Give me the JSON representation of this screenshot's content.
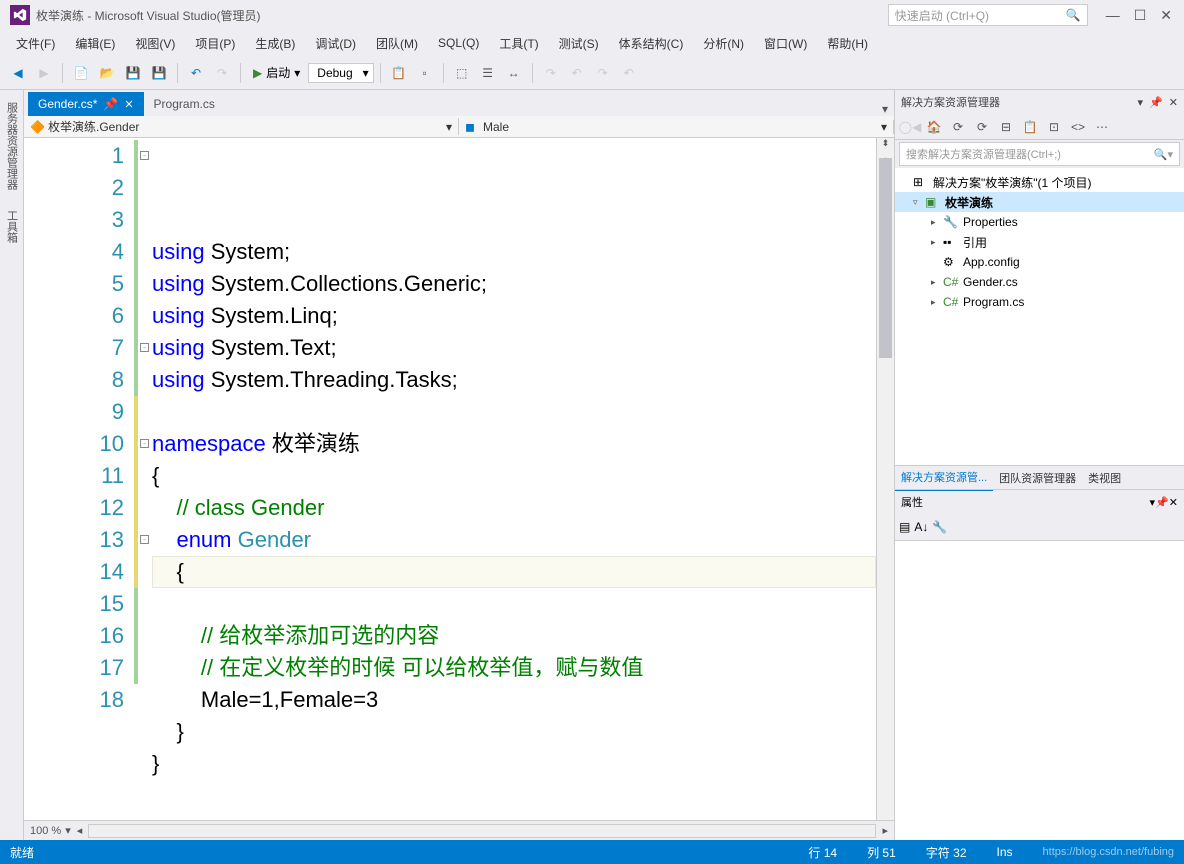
{
  "window": {
    "title": "枚举演练 - Microsoft Visual Studio(管理员)",
    "quicklaunch_placeholder": "快速启动 (Ctrl+Q)"
  },
  "menu": {
    "file": "文件(F)",
    "edit": "编辑(E)",
    "view": "视图(V)",
    "project": "项目(P)",
    "build": "生成(B)",
    "debug": "调试(D)",
    "team": "团队(M)",
    "sql": "SQL(Q)",
    "tools": "工具(T)",
    "test": "测试(S)",
    "architecture": "体系结构(C)",
    "analyze": "分析(N)",
    "window": "窗口(W)",
    "help": "帮助(H)"
  },
  "toolbar": {
    "start_label": "启动",
    "config": "Debug"
  },
  "side_panels": {
    "server_explorer": "服务器资源管理器",
    "toolbox": "工具箱"
  },
  "tabs": {
    "active": "Gender.cs*",
    "inactive": "Program.cs"
  },
  "navbar": {
    "left": "枚举演练.Gender",
    "right": "Male"
  },
  "code_lines": [
    {
      "n": 1,
      "tokens": [
        {
          "t": "using",
          "c": "kw"
        },
        {
          "t": " System;",
          "c": ""
        }
      ]
    },
    {
      "n": 2,
      "tokens": [
        {
          "t": "using",
          "c": "kw"
        },
        {
          "t": " System.Collections.Generic;",
          "c": ""
        }
      ]
    },
    {
      "n": 3,
      "tokens": [
        {
          "t": "using",
          "c": "kw"
        },
        {
          "t": " System.Linq;",
          "c": ""
        }
      ]
    },
    {
      "n": 4,
      "tokens": [
        {
          "t": "using",
          "c": "kw"
        },
        {
          "t": " System.Text;",
          "c": ""
        }
      ]
    },
    {
      "n": 5,
      "tokens": [
        {
          "t": "using",
          "c": "kw"
        },
        {
          "t": " System.Threading.Tasks;",
          "c": ""
        }
      ]
    },
    {
      "n": 6,
      "tokens": []
    },
    {
      "n": 7,
      "tokens": [
        {
          "t": "namespace",
          "c": "kw"
        },
        {
          "t": " 枚举演练",
          "c": ""
        }
      ]
    },
    {
      "n": 8,
      "tokens": [
        {
          "t": "{",
          "c": ""
        }
      ]
    },
    {
      "n": 9,
      "tokens": [
        {
          "t": "    ",
          "c": ""
        },
        {
          "t": "// class Gender",
          "c": "cm"
        }
      ]
    },
    {
      "n": 10,
      "tokens": [
        {
          "t": "    ",
          "c": ""
        },
        {
          "t": "enum",
          "c": "kw"
        },
        {
          "t": " ",
          "c": ""
        },
        {
          "t": "Gender",
          "c": "tp"
        }
      ]
    },
    {
      "n": 11,
      "tokens": [
        {
          "t": "    {",
          "c": ""
        }
      ]
    },
    {
      "n": 12,
      "tokens": []
    },
    {
      "n": 13,
      "tokens": [
        {
          "t": "        ",
          "c": ""
        },
        {
          "t": "// 给枚举添加可选的内容",
          "c": "cm"
        }
      ]
    },
    {
      "n": 14,
      "tokens": [
        {
          "t": "        ",
          "c": ""
        },
        {
          "t": "// 在定义枚举的时候 可以给枚举值，赋与数值",
          "c": "cm"
        }
      ]
    },
    {
      "n": 15,
      "tokens": [
        {
          "t": "        Male=1,Female=3",
          "c": ""
        }
      ]
    },
    {
      "n": 16,
      "tokens": [
        {
          "t": "    }",
          "c": ""
        }
      ]
    },
    {
      "n": 17,
      "tokens": [
        {
          "t": "}",
          "c": ""
        }
      ]
    },
    {
      "n": 18,
      "tokens": []
    }
  ],
  "zoom": "100 %",
  "solution_explorer": {
    "title": "解决方案资源管理器",
    "search_placeholder": "搜索解决方案资源管理器(Ctrl+;)",
    "solution": "解决方案\"枚举演练\"(1 个项目)",
    "project": "枚举演练",
    "items": {
      "properties": "Properties",
      "references": "引用",
      "appconfig": "App.config",
      "gender": "Gender.cs",
      "program": "Program.cs"
    },
    "tabs": {
      "sol": "解决方案资源管...",
      "team": "团队资源管理器",
      "classview": "类视图"
    }
  },
  "properties": {
    "title": "属性"
  },
  "statusbar": {
    "ready": "就绪",
    "line": "行 14",
    "col": "列 51",
    "char_label": "字符",
    "char_val": "32",
    "ins": "Ins",
    "watermark": "https://blog.csdn.net/fubing"
  }
}
